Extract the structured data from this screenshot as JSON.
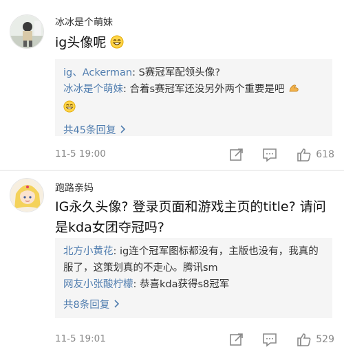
{
  "comments": [
    {
      "username": "冰冰是个萌妹",
      "text": "ig头像呢",
      "replies": [
        {
          "nick": "ig、Ackerman",
          "text": "S赛冠军配领头像?"
        },
        {
          "nick": "冰冰是个萌妹",
          "text": "合着s赛冠军还没另外两个重要是吧"
        }
      ],
      "more_label": "共45条回复",
      "time": "11-5 19:00",
      "likes": "618"
    },
    {
      "username": "跑路亲妈",
      "text": "IG永久头像? 登录页面和游戏主页的title? 请问是kda女团夺冠吗?",
      "replies": [
        {
          "nick": "北方小黄花",
          "text": "ig连个冠军图标都没有，主版也没有，我真的服了，这策划真的不走心。腾讯sm"
        },
        {
          "nick": "网友小张酸柠檬",
          "text": "恭喜kda获得s8冠军"
        }
      ],
      "more_label": "共8条回复",
      "time": "11-5 19:01",
      "likes": "529"
    }
  ],
  "colors": {
    "link": "#507daf",
    "reply_bg": "#f5f5f5",
    "meta": "#888888"
  },
  "icons": [
    "avatar",
    "smile-emoji-icon",
    "strong-emoji-icon",
    "chevron-right-icon",
    "share-icon",
    "comment-icon",
    "like-icon"
  ]
}
